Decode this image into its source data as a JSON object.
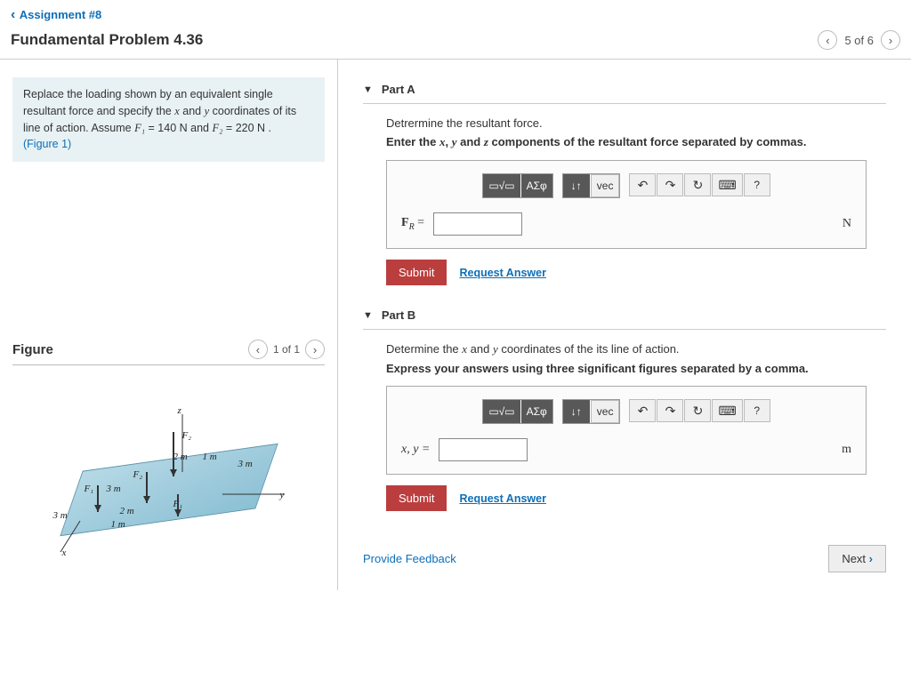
{
  "breadcrumb": "Assignment #8",
  "title": "Fundamental Problem 4.36",
  "pager": {
    "text": "5 of 6"
  },
  "problem": {
    "text_before": "Replace the loading shown by an equivalent single resultant force and specify the ",
    "var1": "x",
    "and1": " and ",
    "var2": "y",
    "text_mid": " coordinates of its line of action. Assume ",
    "f1label": "F₁",
    "eq1": " = 140 N and ",
    "f2label": "F₂",
    "eq2": " = 220 N .",
    "figure_link": "(Figure 1)"
  },
  "figure": {
    "heading": "Figure",
    "pager": "1 of 1",
    "labels": {
      "z": "z",
      "y": "y",
      "x": "x",
      "F1a": "F₁",
      "F1b": "F₁",
      "F2a": "F₂",
      "F2b": "F₂",
      "d3ma": "3 m",
      "d3mb": "3 m",
      "d3mc": "3 m",
      "d2ma": "2 m",
      "d2mb": "2 m",
      "d1ma": "1 m",
      "d1mb": "1 m"
    }
  },
  "partA": {
    "title": "Part A",
    "desc": "Detrermine the resultant force.",
    "instruction_pre": "Enter the ",
    "ix": "x",
    "c1": ", ",
    "iy": "y",
    "c2": " and ",
    "iz": "z",
    "instruction_post": " components of the resultant force separated by commas.",
    "answer_label_html": "F",
    "answer_sub": "R",
    "equals": " = ",
    "unit": "N",
    "value": ""
  },
  "partB": {
    "title": "Part B",
    "desc_pre": "Determine the ",
    "dx": "x",
    "dand": " and ",
    "dy": "y",
    "desc_post": " coordinates of the its line of action.",
    "instruction": "Express your answers using three significant figures separated by a comma.",
    "answer_label": "x, y = ",
    "unit": "m",
    "value": ""
  },
  "toolbar": {
    "templates": "▭√▭",
    "greek": "ΑΣφ",
    "subsup": "↓↑",
    "vec": "vec",
    "undo": "↶",
    "redo": "↷",
    "reset": "↻",
    "keyboard": "⌨",
    "help": "?"
  },
  "actions": {
    "submit": "Submit",
    "request": "Request Answer",
    "feedback": "Provide Feedback",
    "next": "Next"
  }
}
